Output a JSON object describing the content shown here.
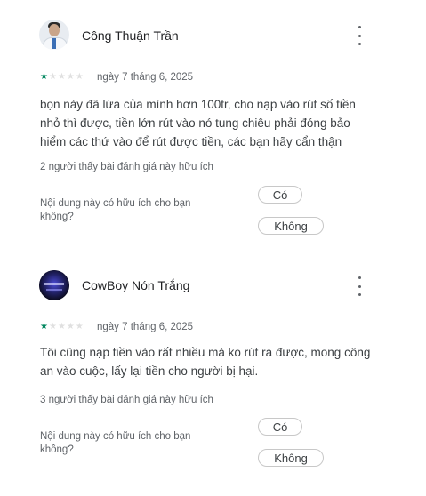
{
  "reviews": [
    {
      "author": "Công Thuận Trần",
      "rating": 1,
      "date": "ngày 7 tháng 6, 2025",
      "text": "bọn này đã lừa của mình hơn 100tr, cho nạp vào rút số tiền nhỏ thì được, tiền lớn rút vào nó tung chiêu phải đóng bảo hiểm các thứ vào để rút được tiền, các bạn hãy cẩn thận",
      "helpful_count": "2 người thấy bài đánh giá này hữu ích",
      "question": "Nội dung này có hữu ích cho bạn không?",
      "yes_label": "Có",
      "no_label": "Không"
    },
    {
      "author": "CowBoy Nón Trắng",
      "rating": 1,
      "date": "ngày 7 tháng 6, 2025",
      "text": "Tôi cũng nạp tiền vào rất nhiều mà ko rút ra được, mong công an vào cuộc, lấy lại tiền cho người bị hại.",
      "helpful_count": "3 người thấy bài đánh giá này hữu ích",
      "question": "Nội dung này có hữu ích cho bạn không?",
      "yes_label": "Có",
      "no_label": "Không"
    }
  ],
  "icons": {
    "more": "more-vert-icon",
    "star": "star-icon"
  },
  "colors": {
    "star_on": "#01875f",
    "star_off": "#e0e0e0"
  }
}
